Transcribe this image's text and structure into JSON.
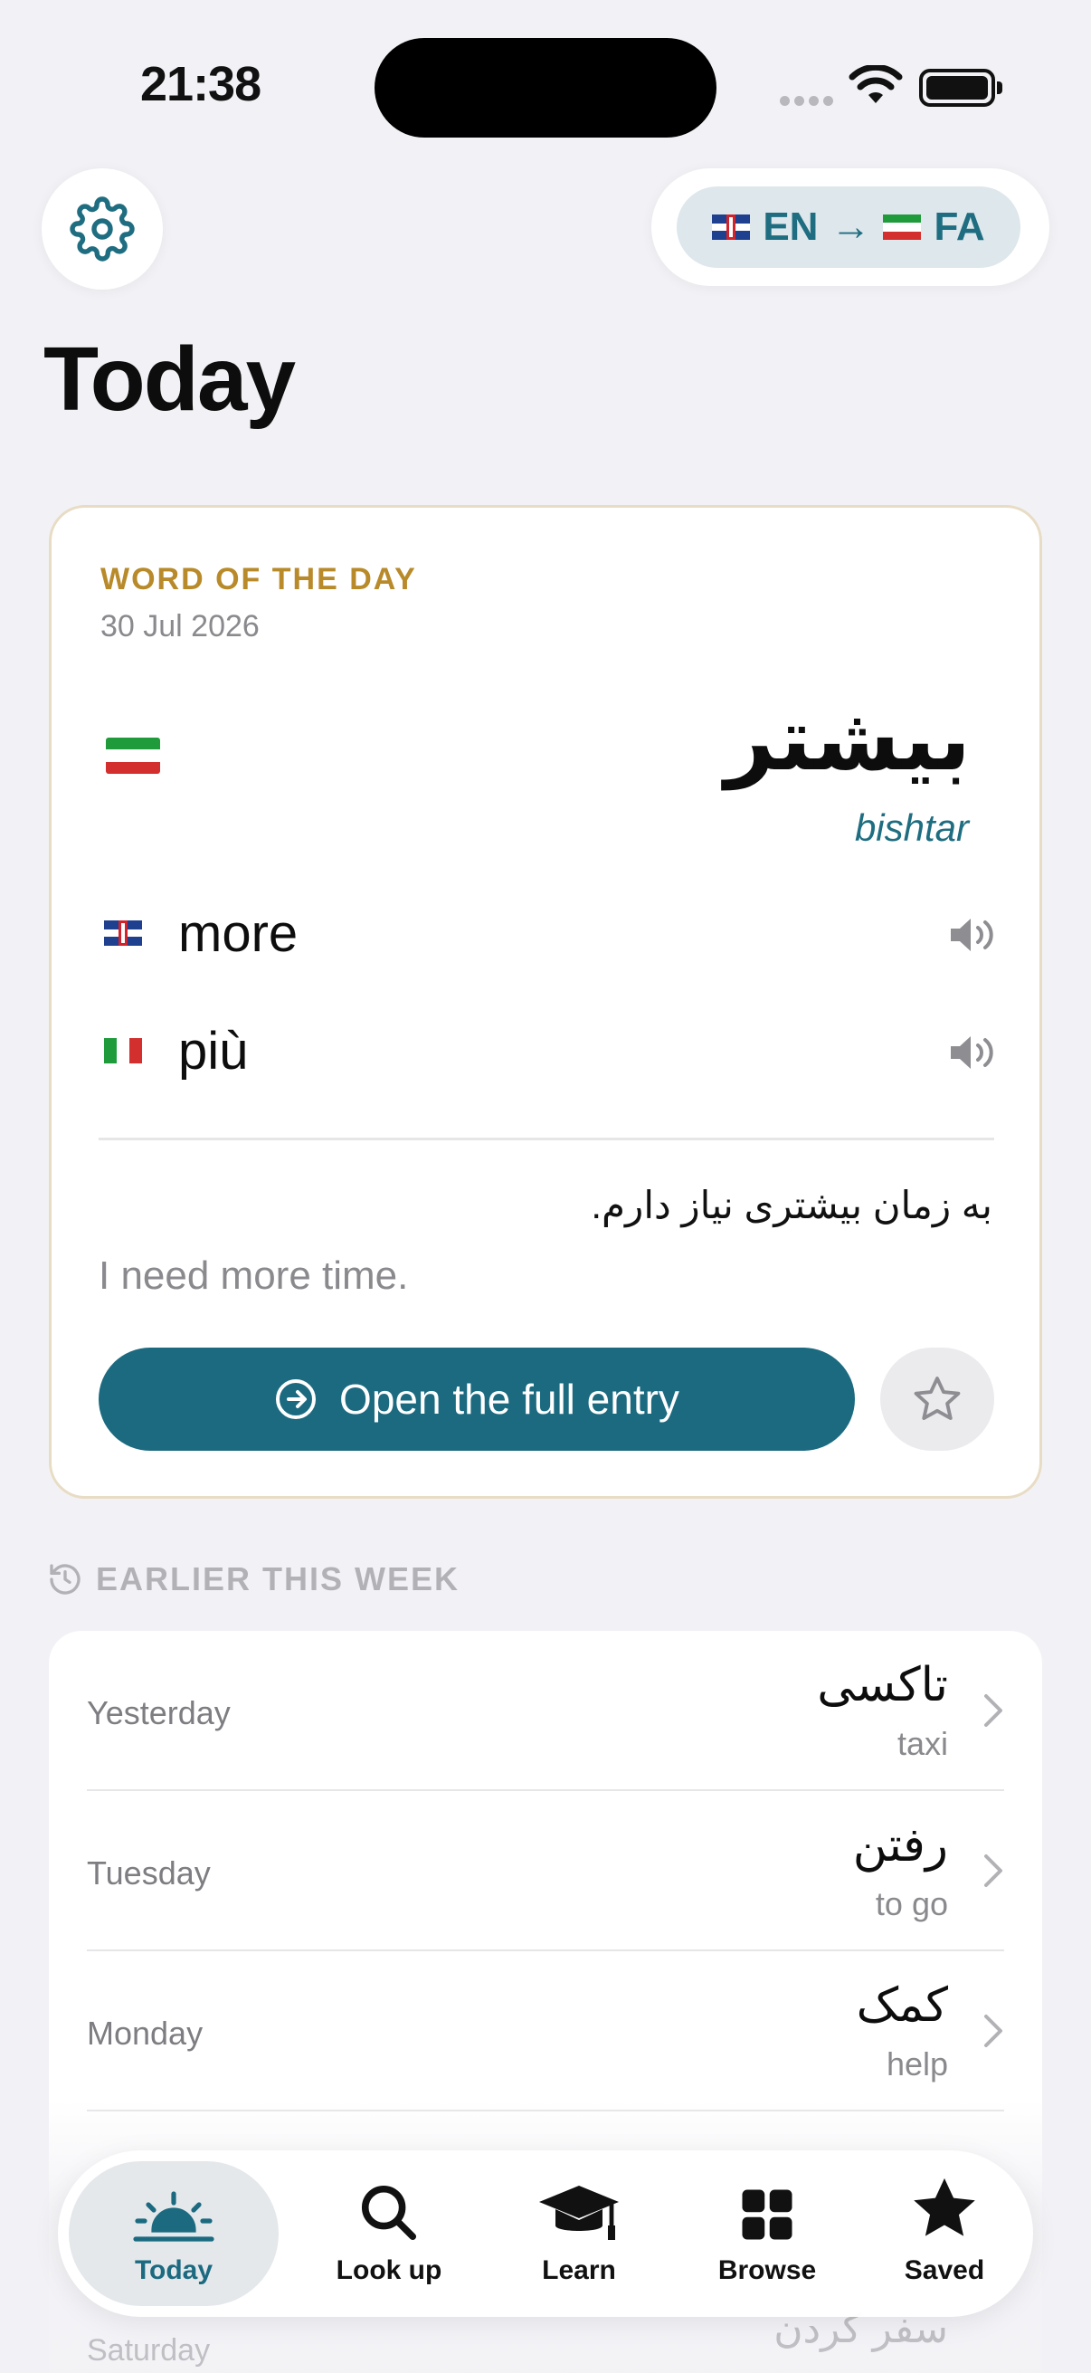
{
  "status_bar": {
    "time": "21:38"
  },
  "header": {
    "settings_icon": "gear-icon",
    "language_pair": {
      "source_flag": "uk-flag",
      "source": "EN",
      "arrow": "→",
      "target_flag": "iran-flag",
      "target": "FA"
    }
  },
  "page_title": "Today",
  "word_of_the_day": {
    "label": "WORD OF THE DAY",
    "date": "30 Jul 2026",
    "word": "بیشتر",
    "transliteration": "bishtar",
    "translations": [
      {
        "flag": "uk-flag",
        "text": "more"
      },
      {
        "flag": "italy-flag",
        "text": "più"
      }
    ],
    "example": "به زمان بیشتری نیاز دارم.",
    "example_translation": "I need more time.",
    "open_button": "Open the full entry",
    "accent_color": "#1c6a80",
    "label_color": "#b88a2a"
  },
  "history": {
    "section_label": "EARLIER THIS WEEK",
    "items": [
      {
        "day": "Yesterday",
        "word": "تاکسی",
        "translation": "taxi"
      },
      {
        "day": "Tuesday",
        "word": "رفتن",
        "translation": "to go"
      },
      {
        "day": "Monday",
        "word": "کمک",
        "translation": "help"
      }
    ],
    "peek": {
      "day": "Saturday",
      "word": "سفر کردن"
    }
  },
  "tab_bar": {
    "tabs": [
      {
        "label": "Today",
        "icon": "sunrise-icon",
        "active": true
      },
      {
        "label": "Look up",
        "icon": "search-icon",
        "active": false
      },
      {
        "label": "Learn",
        "icon": "graduation-cap-icon",
        "active": false
      },
      {
        "label": "Browse",
        "icon": "grid-icon",
        "active": false
      },
      {
        "label": "Saved",
        "icon": "star-icon",
        "active": false
      }
    ]
  }
}
